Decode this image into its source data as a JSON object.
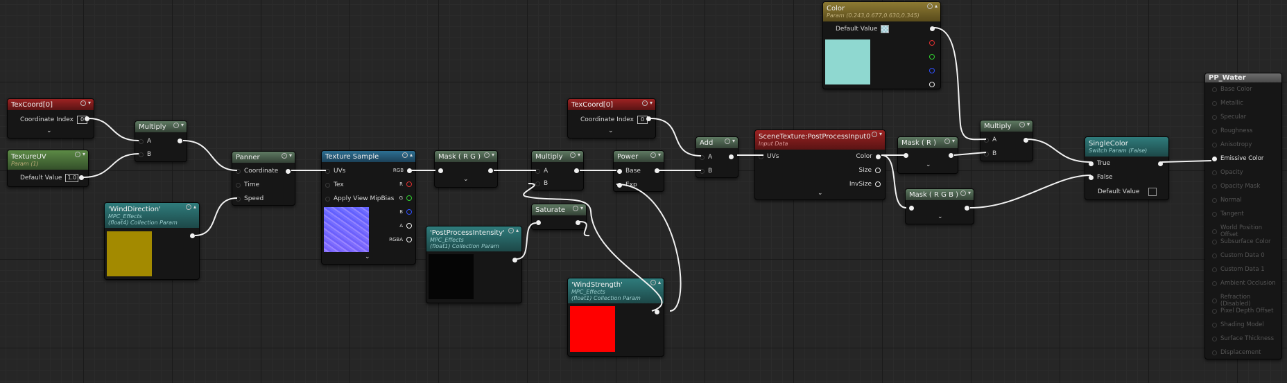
{
  "nodes": {
    "texcoord1": {
      "title": "TexCoord[0]",
      "pin": "Coordinate Index",
      "value": "0"
    },
    "textureuv": {
      "title": "TextureUV",
      "subtitle": "Param (1)",
      "pin": "Default Value",
      "value": "1.0"
    },
    "multiply1": {
      "title": "Multiply",
      "a": "A",
      "b": "B"
    },
    "winddir": {
      "title": "'WindDirection'",
      "sub1": "MPC_Effects",
      "sub2": "(float4) Collection Param",
      "color": "#a38a00"
    },
    "panner": {
      "title": "Panner",
      "p1": "Coordinate",
      "p2": "Time",
      "p3": "Speed"
    },
    "texsample": {
      "title": "Texture Sample",
      "p1": "UVs",
      "p2": "Tex",
      "p3": "Apply View MipBias",
      "o1": "RGB",
      "o2": "R",
      "o3": "G",
      "o4": "B",
      "o5": "A",
      "o6": "RGBA"
    },
    "maskrg": {
      "title": "Mask ( R G )"
    },
    "ppintensity": {
      "title": "'PostProcessIntensity'",
      "sub1": "MPC_Effects",
      "sub2": "(float1) Collection Param",
      "color": "#050505"
    },
    "multiply2": {
      "title": "Multiply",
      "a": "A",
      "b": "B"
    },
    "saturate": {
      "title": "Saturate"
    },
    "power": {
      "title": "Power",
      "a": "Base",
      "b": "Exp"
    },
    "windstrength": {
      "title": "'WindStrength'",
      "sub1": "MPC_Effects",
      "sub2": "(float1) Collection Param",
      "color": "#ff0000"
    },
    "texcoord2": {
      "title": "TexCoord[0]",
      "pin": "Coordinate Index",
      "value": "0"
    },
    "add": {
      "title": "Add",
      "a": "A",
      "b": "B"
    },
    "scenetex": {
      "title": "SceneTexture:PostProcessInput0",
      "subtitle": "Input Data",
      "p1": "UVs",
      "o1": "Color",
      "o2": "Size",
      "o3": "InvSize"
    },
    "maskr": {
      "title": "Mask ( R )"
    },
    "maskrgb": {
      "title": "Mask ( R G B )"
    },
    "color": {
      "title": "Color",
      "subtitle": "Param (0.243,0.677,0.630,0.345)",
      "pin": "Default Value",
      "color": "#8fd8d0"
    },
    "multiply3": {
      "title": "Multiply",
      "a": "A",
      "b": "B"
    },
    "singlecolor": {
      "title": "SingleColor",
      "subtitle": "Switch Param (False)",
      "p1": "True",
      "p2": "False",
      "p3": "Default Value"
    }
  },
  "result": {
    "title": "PP_Water",
    "pins": [
      "Base Color",
      "Metallic",
      "Specular",
      "Roughness",
      "Anisotropy",
      "Emissive Color",
      "Opacity",
      "Opacity Mask",
      "Normal",
      "Tangent",
      "World Position Offset",
      "Subsurface Color",
      "Custom Data 0",
      "Custom Data 1",
      "Ambient Occlusion",
      "Refraction (Disabled)",
      "Pixel Depth Offset",
      "Shading Model",
      "Surface Thickness",
      "Displacement"
    ]
  }
}
